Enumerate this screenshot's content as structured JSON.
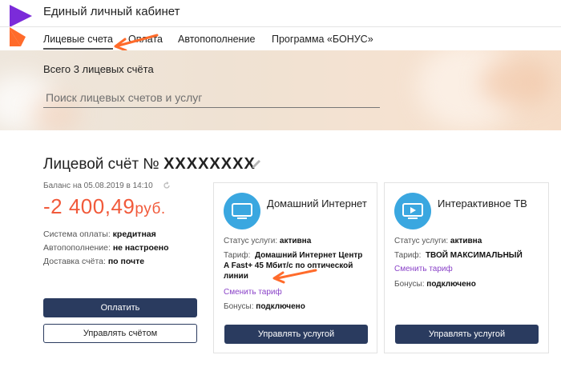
{
  "header": {
    "title": "Единый личный кабинет",
    "nav": [
      {
        "label": "Лицевые счета",
        "active": true
      },
      {
        "label": "Оплата",
        "active": false
      },
      {
        "label": "Автопополнение",
        "active": false
      },
      {
        "label": "Программа «БОНУС»",
        "active": false
      }
    ],
    "brand_color": "#7b2bd9",
    "accent_color": "#ff6b2b"
  },
  "hero": {
    "accounts_count": "Всего 3 лицевых счёта",
    "search_placeholder": "Поиск лицевых счетов и услуг"
  },
  "account": {
    "title_prefix": "Лицевой счёт №",
    "number": "XXXXXXXX",
    "edit_icon": "pencil-icon",
    "balance_date": "Баланс на 05.08.2019 в 14:10",
    "refresh_icon": "refresh-icon",
    "balance_amount": "-2 400,49",
    "balance_currency": "руб.",
    "balance_color": "#f15a3b",
    "payment_system_label": "Система оплаты:",
    "payment_system_value": "кредитная",
    "autopay_label": "Автопополнение:",
    "autopay_value": "не настроено",
    "delivery_label": "Доставка счёта:",
    "delivery_value": "по почте",
    "pay_button": "Оплатить",
    "manage_button": "Управлять счётом"
  },
  "services": [
    {
      "title": "Домашний Интернет",
      "icon": "monitor-icon",
      "status_label": "Статус услуги:",
      "status_value": "активна",
      "tariff_label": "Тариф:",
      "tariff_value_line1": "Домашний Интернет Центр",
      "tariff_value_line2": "A Fast+ 45 Мбит/с по оптической",
      "tariff_value_line3": "линии",
      "change_tariff": "Сменить тариф",
      "bonus_label": "Бонусы:",
      "bonus_value": "подключено",
      "manage_button": "Управлять услугой"
    },
    {
      "title": "Интерактивное ТВ",
      "icon": "tv-play-icon",
      "status_label": "Статус услуги:",
      "status_value": "активна",
      "tariff_label": "Тариф:",
      "tariff_value_line1": "ТВОЙ МАКСИМАЛЬНЫЙ",
      "change_tariff": "Сменить тариф",
      "bonus_label": "Бонусы:",
      "bonus_value": "подключено",
      "manage_button": "Управлять услугой"
    }
  ],
  "colors": {
    "button_dark": "#2a3b5f",
    "link_purple": "#8a42c8",
    "icon_blue": "#3aa7e0",
    "annotation_arrow": "#ff6b2b"
  }
}
